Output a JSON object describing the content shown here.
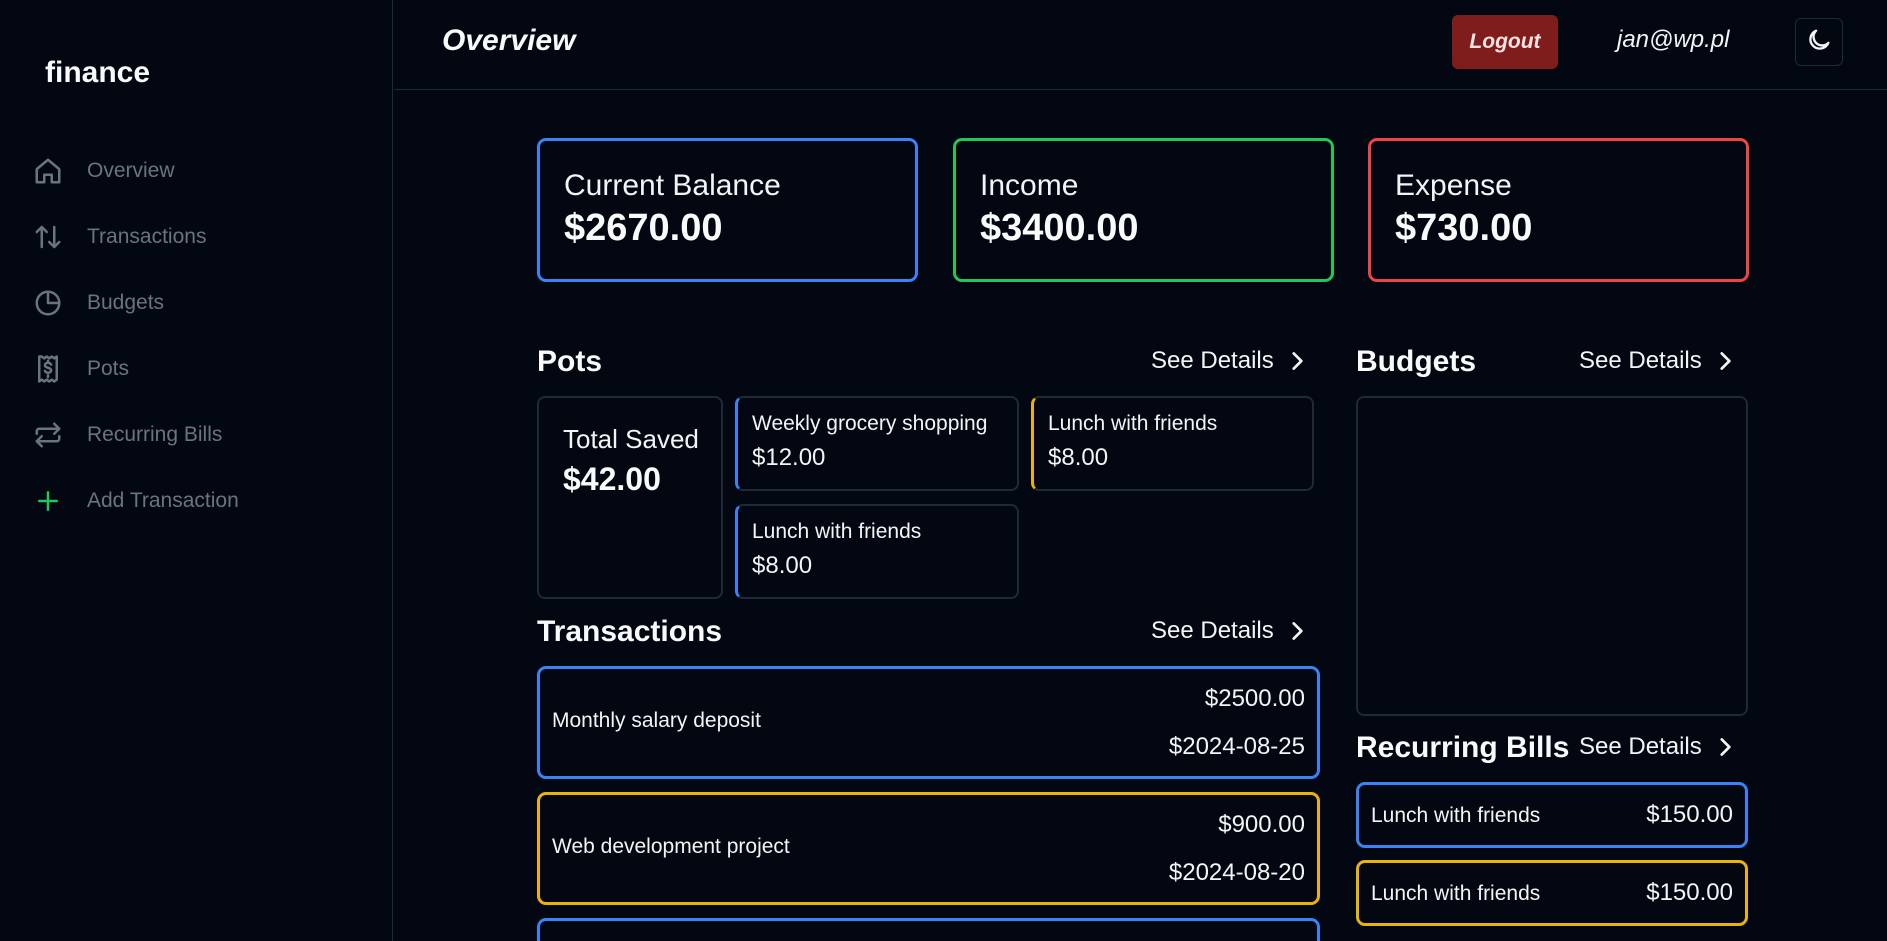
{
  "app": {
    "brand": "finance",
    "page_title": "Overview"
  },
  "sidebar": {
    "items": [
      {
        "label": "Overview",
        "icon": "home-icon"
      },
      {
        "label": "Transactions",
        "icon": "arrows-up-down-icon"
      },
      {
        "label": "Budgets",
        "icon": "pie-chart-icon"
      },
      {
        "label": "Pots",
        "icon": "receipt-dollar-icon"
      },
      {
        "label": "Recurring Bills",
        "icon": "repeat-icon"
      },
      {
        "label": "Add Transaction",
        "icon": "plus-icon"
      }
    ]
  },
  "header": {
    "logout_label": "Logout",
    "user_email": "jan@wp.pl",
    "theme_icon": "moon-icon"
  },
  "stats": [
    {
      "label": "Current Balance",
      "value": "$2670.00",
      "color": "#3b82f6"
    },
    {
      "label": "Income",
      "value": "$3400.00",
      "color": "#22c55e"
    },
    {
      "label": "Expense",
      "value": "$730.00",
      "color": "#ef4444"
    }
  ],
  "pots": {
    "title": "Pots",
    "see_details": "See Details",
    "total_label": "Total Saved",
    "total_value": "$42.00",
    "items": [
      {
        "name": "Weekly grocery shopping",
        "amount": "$12.00",
        "color": "#3b82f6"
      },
      {
        "name": "Lunch with friends",
        "amount": "$8.00",
        "color": "#eab308"
      },
      {
        "name": "Lunch with friends",
        "amount": "$8.00",
        "color": "#3b82f6"
      }
    ]
  },
  "budgets": {
    "title": "Budgets",
    "see_details": "See Details"
  },
  "transactions": {
    "title": "Transactions",
    "see_details": "See Details",
    "items": [
      {
        "description": "Monthly salary deposit",
        "amount": "$2500.00",
        "date": "$2024-08-25",
        "color": "#3b82f6"
      },
      {
        "description": "Web development project",
        "amount": "$900.00",
        "date": "$2024-08-20",
        "color": "#eab308"
      },
      {
        "color": "#3b82f6"
      }
    ]
  },
  "recurring_bills": {
    "title": "Recurring Bills",
    "see_details": "See Details",
    "items": [
      {
        "name": "Lunch with friends",
        "amount": "$150.00",
        "color": "#3b82f6"
      },
      {
        "name": "Lunch with friends",
        "amount": "$150.00",
        "color": "#eab308"
      }
    ]
  },
  "colors": {
    "background": "#030712",
    "border": "#1f2937",
    "logout_bg": "#7f1d1d",
    "muted_text": "#6b7280"
  }
}
